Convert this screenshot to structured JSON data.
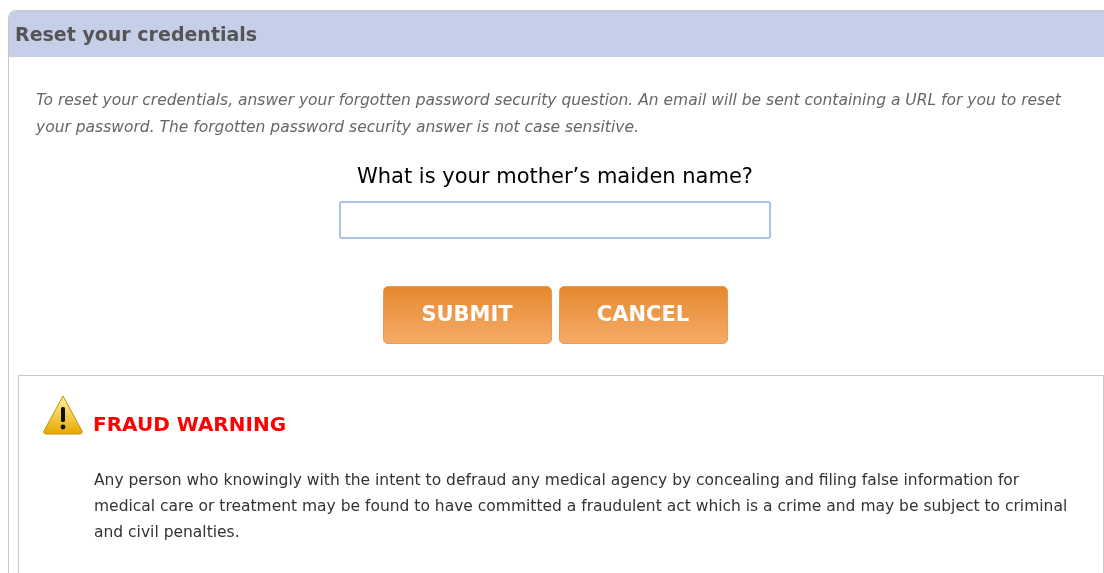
{
  "panel": {
    "title": "Reset your credentials",
    "instructions": "To reset your credentials, answer your forgotten password security question. An email will be sent containing a URL for you to reset your password. The forgotten password security answer is not case sensitive.",
    "question": "What is your mother’s maiden name?",
    "buttons": [
      "SUBMIT",
      "CANCEL"
    ]
  },
  "warning": {
    "title": "FRAUD WARNING",
    "text": "Any person who knowingly with the intent to defraud any medical agency by concealing and filing false information for medical care or treatment may be found to have committed a fraudulent act which is a crime and may be subject to criminal and civil penalties."
  }
}
